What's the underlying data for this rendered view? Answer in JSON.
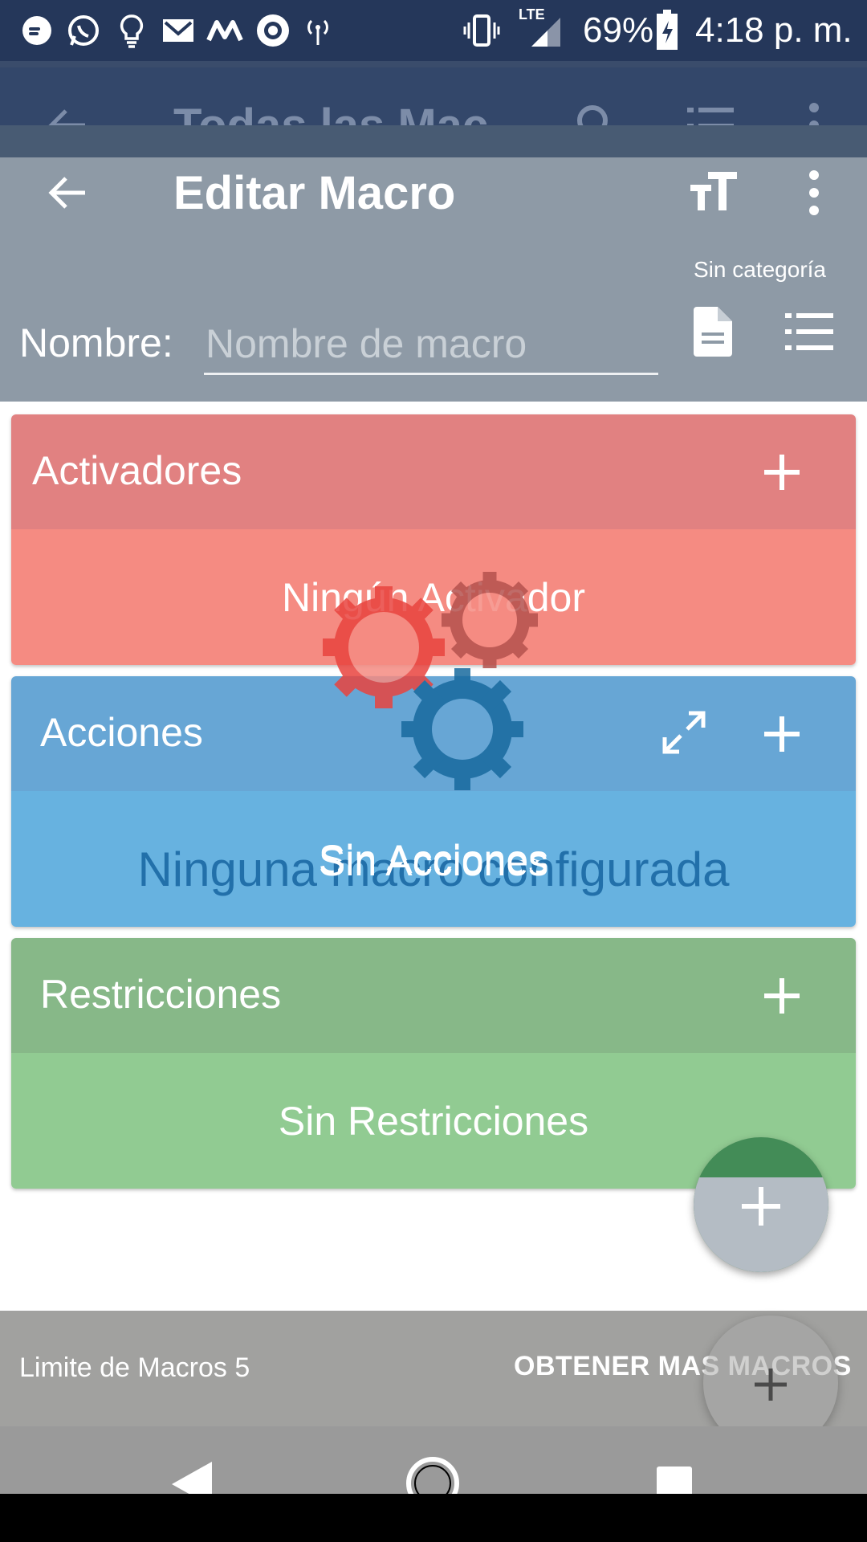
{
  "status_bar": {
    "battery": "69%",
    "time": "4:18 p. m.",
    "network": "LTE",
    "icons": [
      "messenger-icon",
      "whatsapp-icon",
      "lightbulb-icon",
      "gmail-icon",
      "m-app-icon",
      "record-icon",
      "hotspot-icon",
      "vibrate-icon",
      "signal-icon",
      "battery-charging-icon"
    ]
  },
  "background_toolbar": {
    "title": "Todas las Mac..."
  },
  "header": {
    "title": "Editar Macro",
    "category": "Sin categoría",
    "name_label": "Nombre:",
    "name_placeholder": "Nombre de macro",
    "name_value": ""
  },
  "sections": {
    "triggers": {
      "title": "Activadores",
      "empty": "Ningún Activador",
      "head_color": "#e18181",
      "body_color": "#f58b82"
    },
    "actions": {
      "title": "Acciones",
      "empty": "Sin Acciones",
      "head_color": "#67a6d5",
      "body_color": "#67b2e0"
    },
    "constraints": {
      "title": "Restricciones",
      "empty": "Sin Restricciones",
      "head_color": "#87b888",
      "body_color": "#91cb92"
    }
  },
  "overlay": {
    "empty_message": "Ninguna macro configurada"
  },
  "bottom_bar": {
    "limit_text": "Limite de Macros 5",
    "get_more": "OBTENER MAS MACROS"
  },
  "colors": {
    "status_bar": "#25375a",
    "header": "#8e9aa6",
    "fab_green": "#438c57",
    "fab_grey": "#b4bcc4"
  }
}
